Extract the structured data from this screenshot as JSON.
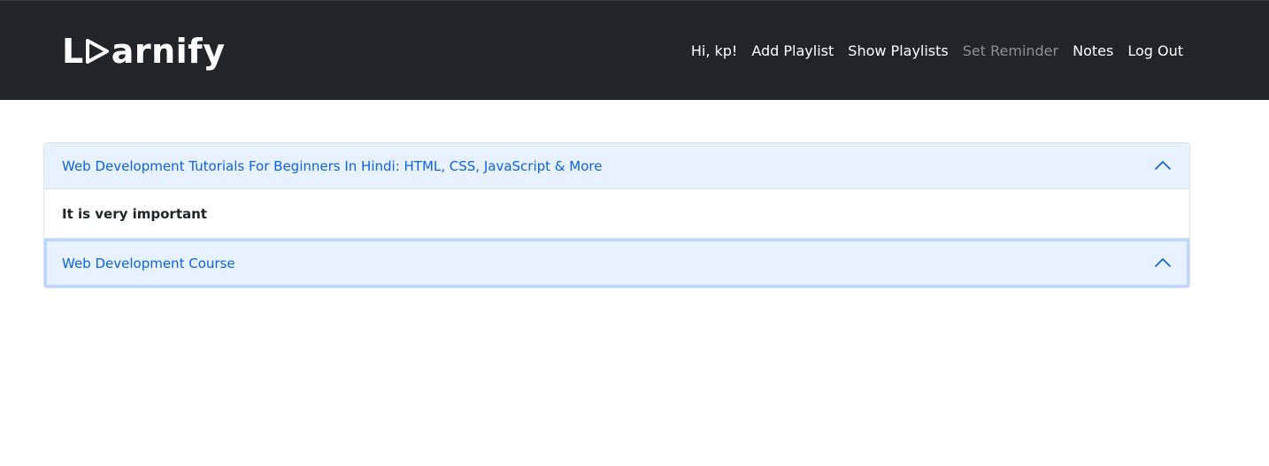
{
  "brand": {
    "prefix": "L",
    "suffix": "arnify"
  },
  "nav": {
    "greeting": "Hi, kp!",
    "links": [
      "Add Playlist",
      "Show Playlists",
      "Set Reminder",
      "Notes",
      "Log Out"
    ]
  },
  "accordion": {
    "items": [
      {
        "title": "Web Development Tutorials For Beginners In Hindi: HTML, CSS, JavaScript & More",
        "body": "It is very important",
        "icon": "chevron-up-icon"
      },
      {
        "title": "Web Development Course",
        "icon": "chevron-up-icon"
      }
    ]
  },
  "colors": {
    "navbar": "#212529",
    "accordion_header_bg": "#e7f1ff",
    "accordion_header_text": "#0c63e4",
    "muted_link": "#8c8f93"
  }
}
